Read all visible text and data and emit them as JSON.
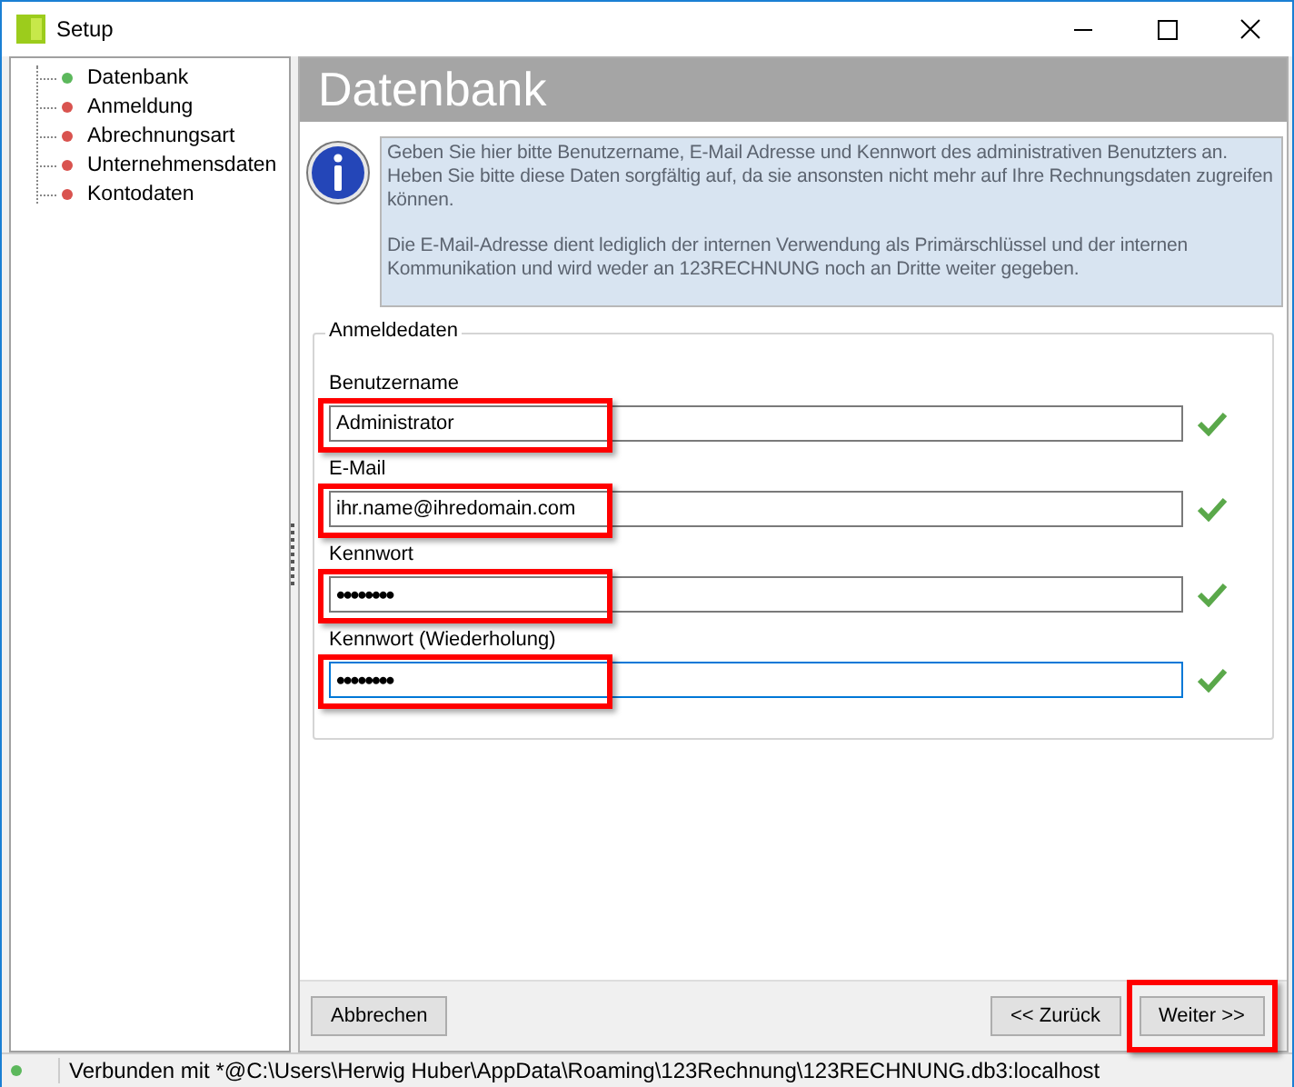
{
  "window": {
    "title": "Setup"
  },
  "sidebar": {
    "items": [
      {
        "label": "Datenbank",
        "color": "#5cb85c"
      },
      {
        "label": "Anmeldung",
        "color": "#d9534f"
      },
      {
        "label": "Abrechnungsart",
        "color": "#d9534f"
      },
      {
        "label": "Unternehmensdaten",
        "color": "#d9534f"
      },
      {
        "label": "Kontodaten",
        "color": "#d9534f"
      }
    ]
  },
  "header": {
    "title": "Datenbank"
  },
  "info": {
    "paragraphs": [
      "Geben Sie hier bitte Benutzername, E-Mail Adresse und Kennwort des administrativen Benutzters an. Heben Sie bitte diese Daten sorgfältig auf, da sie ansonsten nicht mehr auf Ihre Rechnungsdaten zugreifen können.",
      "Die E-Mail-Adresse dient lediglich der internen Verwendung als Primärschlüssel und der internen Kommunikation und wird weder an 123RECHNUNG noch an Dritte weiter gegeben."
    ]
  },
  "group": {
    "title": "Anmeldedaten",
    "fields": [
      {
        "label": "Benutzername",
        "value": "Administrator",
        "kind": "text",
        "focused": false,
        "highlighted": true,
        "valid": true
      },
      {
        "label": "E-Mail",
        "value": "ihr.name@ihredomain.com",
        "kind": "text",
        "focused": false,
        "highlighted": true,
        "valid": true
      },
      {
        "label": "Kennwort",
        "value": "••••••••",
        "kind": "password",
        "focused": false,
        "highlighted": true,
        "valid": true
      },
      {
        "label": "Kennwort (Wiederholung)",
        "value": "••••••••",
        "kind": "password",
        "focused": true,
        "highlighted": true,
        "valid": true
      }
    ]
  },
  "buttons": [
    {
      "label": "Abbrechen"
    },
    {
      "label": "<< Zurück"
    },
    {
      "label": "Weiter >>",
      "highlighted": true
    }
  ],
  "status_bar": {
    "text": "Verbunden mit *@C:\\Users\\Herwig Huber\\AppData\\Roaming\\123Rechnung\\123RECHNUNG.db3:localhost",
    "color": "#5cb85c"
  }
}
